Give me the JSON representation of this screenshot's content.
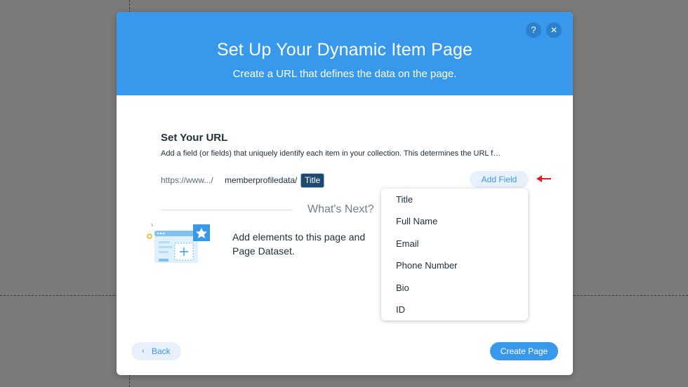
{
  "dialog": {
    "title": "Set Up Your Dynamic Item Page",
    "subtitle": "Create a URL that defines the data on the page.",
    "help_icon": "?",
    "close_icon": "✕"
  },
  "url_section": {
    "title": "Set Your URL",
    "description": "Add a field (or fields) that uniquely identify each item in your collection. This determines the URL f…",
    "url_prefix": "https://www.../",
    "url_path": "memberprofiledata/",
    "url_token": "Title",
    "add_field_label": "Add Field"
  },
  "whats_next": {
    "heading": "What's Next?",
    "text_line1": "Add elements to this page and",
    "text_line2": "Page Dataset."
  },
  "dropdown": {
    "items": [
      "Title",
      "Full Name",
      "Email",
      "Phone Number",
      "Bio",
      "ID"
    ]
  },
  "footer": {
    "back_chevron": "‹",
    "back_label": "Back",
    "create_label": "Create Page"
  },
  "colors": {
    "header_blue": "#3899ec",
    "token_dark": "#1f4a6d",
    "arrow_red": "#e02020",
    "backdrop": "#7b7b7b"
  },
  "icons": [
    "help-icon",
    "close-icon",
    "red-arrow-icon",
    "page-illustration-icon",
    "star-icon",
    "plus-icon",
    "chevron-left-icon"
  ]
}
